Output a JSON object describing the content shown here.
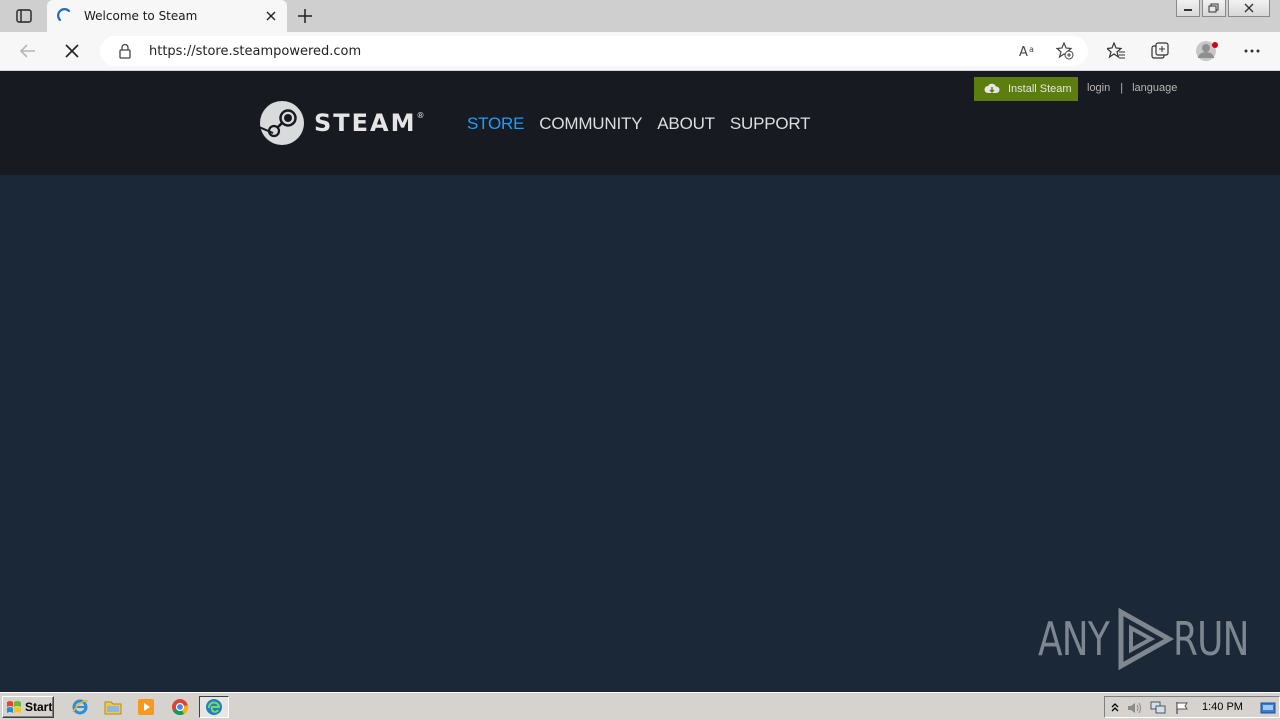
{
  "browser": {
    "tab": {
      "title": "Welcome to Steam"
    },
    "address": {
      "url": "https://store.steampowered.com"
    }
  },
  "steam": {
    "wordmark": "STEAM",
    "registered": "®",
    "nav": [
      {
        "label": "STORE",
        "active": true
      },
      {
        "label": "COMMUNITY",
        "active": false
      },
      {
        "label": "ABOUT",
        "active": false
      },
      {
        "label": "SUPPORT",
        "active": false
      }
    ],
    "install_label": "Install Steam",
    "login_label": "login",
    "separator": "|",
    "language_label": "language"
  },
  "watermark": {
    "text_left": "ANY",
    "text_right": "RUN"
  },
  "taskbar": {
    "start_label": "Start",
    "clock": "1:40 PM"
  },
  "colors": {
    "page_bg": "#1b2838",
    "header_bg": "#171a21",
    "nav_active": "#1a9fff",
    "install_green": "#5c7e10"
  }
}
